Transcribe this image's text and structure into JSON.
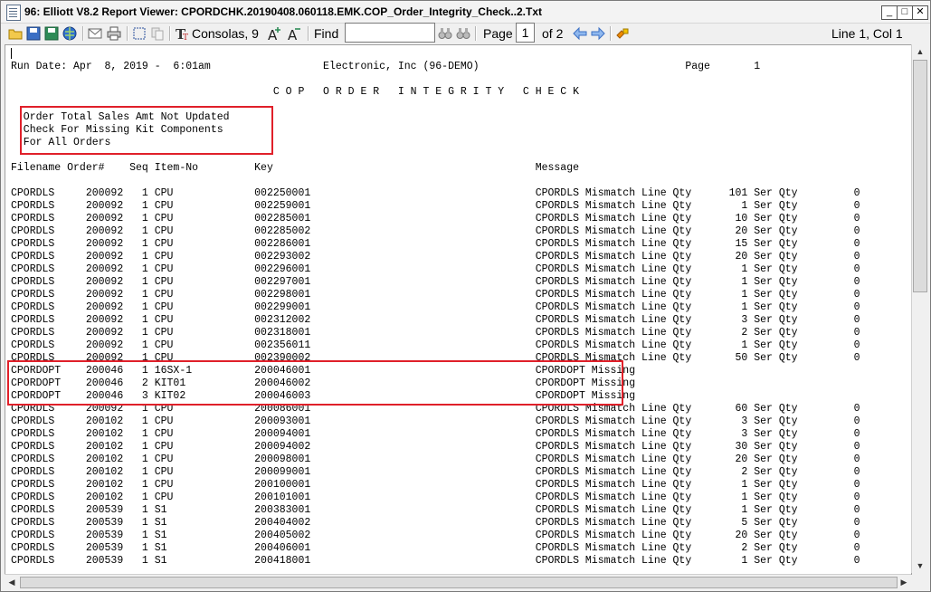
{
  "window": {
    "title": "96: Elliott V8.2 Report Viewer: CPORDCHK.20190408.060118.EMK.COP_Order_Integrity_Check..2.Txt",
    "minimize": "_",
    "maximize": "□",
    "close": "✕"
  },
  "toolbar": {
    "font_label": "Consolas, 9",
    "find_label": "Find",
    "find_value": "",
    "page_label": "Page",
    "page_value": "1",
    "page_of": "of 2",
    "position": "Line 1, Col 1"
  },
  "report": {
    "lines": [
      "Run Date: Apr  8, 2019 -  6:01am                  Electronic, Inc (96-DEMO)                                 Page       1",
      "",
      "                                          C O P   O R D E R   I N T E G R I T Y   C H E C K",
      "",
      "  Order Total Sales Amt Not Updated",
      "  Check For Missing Kit Components",
      "  For All Orders",
      "",
      "Filename Order#    Seq Item-No         Key                                          Message",
      "",
      "CPORDLS     200092   1 CPU             002250001                                    CPORDLS Mismatch Line Qty      101 Ser Qty         0",
      "CPORDLS     200092   1 CPU             002259001                                    CPORDLS Mismatch Line Qty        1 Ser Qty         0",
      "CPORDLS     200092   1 CPU             002285001                                    CPORDLS Mismatch Line Qty       10 Ser Qty         0",
      "CPORDLS     200092   1 CPU             002285002                                    CPORDLS Mismatch Line Qty       20 Ser Qty         0",
      "CPORDLS     200092   1 CPU             002286001                                    CPORDLS Mismatch Line Qty       15 Ser Qty         0",
      "CPORDLS     200092   1 CPU             002293002                                    CPORDLS Mismatch Line Qty       20 Ser Qty         0",
      "CPORDLS     200092   1 CPU             002296001                                    CPORDLS Mismatch Line Qty        1 Ser Qty         0",
      "CPORDLS     200092   1 CPU             002297001                                    CPORDLS Mismatch Line Qty        1 Ser Qty         0",
      "CPORDLS     200092   1 CPU             002298001                                    CPORDLS Mismatch Line Qty        1 Ser Qty         0",
      "CPORDLS     200092   1 CPU             002299001                                    CPORDLS Mismatch Line Qty        1 Ser Qty         0",
      "CPORDLS     200092   1 CPU             002312002                                    CPORDLS Mismatch Line Qty        3 Ser Qty         0",
      "CPORDLS     200092   1 CPU             002318001                                    CPORDLS Mismatch Line Qty        2 Ser Qty         0",
      "CPORDLS     200092   1 CPU             002356011                                    CPORDLS Mismatch Line Qty        1 Ser Qty         0",
      "CPORDLS     200092   1 CPU             002390002                                    CPORDLS Mismatch Line Qty       50 Ser Qty         0",
      "CPORDOPT    200046   1 16SX-1          200046001                                    CPORDOPT Missing",
      "CPORDOPT    200046   2 KIT01           200046002                                    CPORDOPT Missing",
      "CPORDOPT    200046   3 KIT02           200046003                                    CPORDOPT Missing",
      "CPORDLS     200092   1 CPU             200086001                                    CPORDLS Mismatch Line Qty       60 Ser Qty         0",
      "CPORDLS     200102   1 CPU             200093001                                    CPORDLS Mismatch Line Qty        3 Ser Qty         0",
      "CPORDLS     200102   1 CPU             200094001                                    CPORDLS Mismatch Line Qty        3 Ser Qty         0",
      "CPORDLS     200102   1 CPU             200094002                                    CPORDLS Mismatch Line Qty       30 Ser Qty         0",
      "CPORDLS     200102   1 CPU             200098001                                    CPORDLS Mismatch Line Qty       20 Ser Qty         0",
      "CPORDLS     200102   1 CPU             200099001                                    CPORDLS Mismatch Line Qty        2 Ser Qty         0",
      "CPORDLS     200102   1 CPU             200100001                                    CPORDLS Mismatch Line Qty        1 Ser Qty         0",
      "CPORDLS     200102   1 CPU             200101001                                    CPORDLS Mismatch Line Qty        1 Ser Qty         0",
      "CPORDLS     200539   1 S1              200383001                                    CPORDLS Mismatch Line Qty        1 Ser Qty         0",
      "CPORDLS     200539   1 S1              200404002                                    CPORDLS Mismatch Line Qty        5 Ser Qty         0",
      "CPORDLS     200539   1 S1              200405002                                    CPORDLS Mismatch Line Qty       20 Ser Qty         0",
      "CPORDLS     200539   1 S1              200406001                                    CPORDLS Mismatch Line Qty        2 Ser Qty         0",
      "CPORDLS     200539   1 S1              200418001                                    CPORDLS Mismatch Line Qty        1 Ser Qty         0"
    ]
  }
}
